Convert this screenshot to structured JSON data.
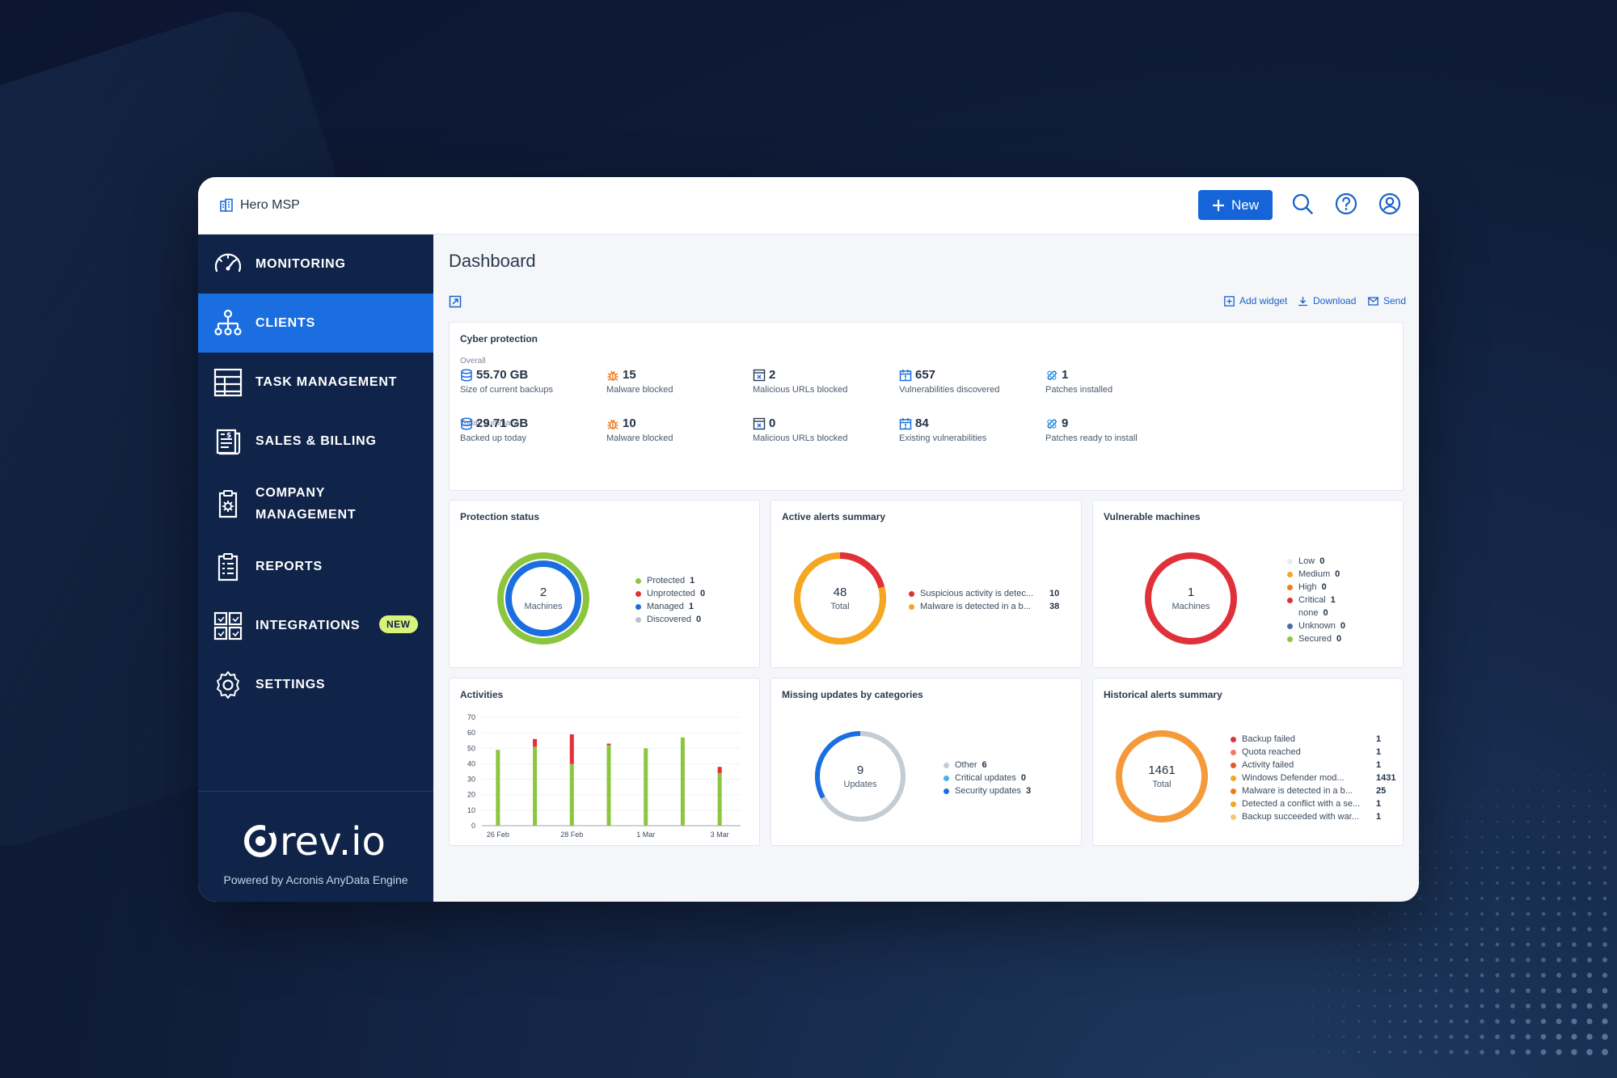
{
  "app": {
    "org_name": "Hero MSP",
    "new_button": "New",
    "page_title": "Dashboard"
  },
  "sidebar": {
    "items": [
      {
        "label": "MONITORING",
        "icon": "speedometer-icon"
      },
      {
        "label": "CLIENTS",
        "icon": "org-chart-icon",
        "active": true
      },
      {
        "label": "TASK MANAGEMENT",
        "icon": "task-board-icon"
      },
      {
        "label": "SALES & BILLING",
        "icon": "invoice-icon"
      },
      {
        "label_line1": "COMPANY",
        "label_line2": "MANAGEMENT",
        "icon": "clipboard-gear-icon"
      },
      {
        "label": "REPORTS",
        "icon": "report-clipboard-icon"
      },
      {
        "label": "INTEGRATIONS",
        "icon": "integrations-grid-icon",
        "badge": "NEW"
      },
      {
        "label": "SETTINGS",
        "icon": "gear-icon"
      }
    ],
    "logo_text": "rev.io",
    "powered_by": "Powered by Acronis AnyData Engine"
  },
  "toolbar": {
    "add_widget": "Add widget",
    "download": "Download",
    "send": "Send"
  },
  "cyber_protection": {
    "title": "Cyber protection",
    "overall_label": "Overall",
    "today_label": "Today summary",
    "overall": [
      {
        "value": "55.70 GB",
        "caption": "Size of current backups",
        "icon": "database-icon"
      },
      {
        "value": "15",
        "caption": "Malware blocked",
        "icon": "bug-icon"
      },
      {
        "value": "2",
        "caption": "Malicious URLs blocked",
        "icon": "blocked-url-icon"
      },
      {
        "value": "657",
        "caption": "Vulnerabilities discovered",
        "icon": "vulnerability-calendar-icon"
      },
      {
        "value": "1",
        "caption": "Patches installed",
        "icon": "patch-icon"
      }
    ],
    "today": [
      {
        "value": "29.71 GB",
        "caption": "Backed up today",
        "icon": "database-icon"
      },
      {
        "value": "10",
        "caption": "Malware blocked",
        "icon": "bug-icon"
      },
      {
        "value": "0",
        "caption": "Malicious URLs blocked",
        "icon": "blocked-url-icon"
      },
      {
        "value": "84",
        "caption": "Existing vulnerabilities",
        "icon": "vulnerability-calendar-icon"
      },
      {
        "value": "9",
        "caption": "Patches ready to install",
        "icon": "patch-icon"
      }
    ]
  },
  "protection_status": {
    "title": "Protection status",
    "center_value": "2",
    "center_label": "Machines",
    "legend": [
      {
        "label": "Protected",
        "value": "1",
        "color": "#8cc63f"
      },
      {
        "label": "Unprotected",
        "value": "0",
        "color": "#e0303a"
      },
      {
        "label": "Managed",
        "value": "1",
        "color": "#1a6ee0"
      },
      {
        "label": "Discovered",
        "value": "0",
        "color": "#b9c2cc"
      }
    ]
  },
  "active_alerts": {
    "title": "Active alerts summary",
    "center_value": "48",
    "center_label": "Total",
    "legend": [
      {
        "label": "Suspicious activity is detec...",
        "value": "10",
        "color": "#e0303a"
      },
      {
        "label": "Malware is detected in a b...",
        "value": "38",
        "color": "#f5a623"
      }
    ]
  },
  "vulnerable_machines": {
    "title": "Vulnerable machines",
    "center_value": "1",
    "center_label": "Machines",
    "legend": [
      {
        "label": "Low",
        "value": "0",
        "color": "#e8ecf2"
      },
      {
        "label": "Medium",
        "value": "0",
        "color": "#f5a623"
      },
      {
        "label": "High",
        "value": "0",
        "color": "#f07b1d"
      },
      {
        "label": "Critical",
        "value": "1",
        "color": "#e0303a"
      },
      {
        "label": "none",
        "value": "0",
        "color": ""
      },
      {
        "label": "Unknown",
        "value": "0",
        "color": "#4a6fa5"
      },
      {
        "label": "Secured",
        "value": "0",
        "color": "#8cc63f"
      }
    ]
  },
  "activities": {
    "title": "Activities"
  },
  "missing_updates": {
    "title": "Missing updates by categories",
    "center_value": "9",
    "center_label": "Updates",
    "legend": [
      {
        "label": "Other",
        "value": "6",
        "color": "#c5ccd4"
      },
      {
        "label": "Critical updates",
        "value": "0",
        "color": "#49b3e8"
      },
      {
        "label": "Security updates",
        "value": "3",
        "color": "#1a6ee0"
      }
    ]
  },
  "historical_alerts": {
    "title": "Historical alerts summary",
    "center_value": "1461",
    "center_label": "Total",
    "legend": [
      {
        "label": "Backup failed",
        "value": "1",
        "color": "#e0303a"
      },
      {
        "label": "Quota reached",
        "value": "1",
        "color": "#f27a6b"
      },
      {
        "label": "Activity failed",
        "value": "1",
        "color": "#e8552b"
      },
      {
        "label": "Windows Defender mod...",
        "value": "1431",
        "color": "#f5a623"
      },
      {
        "label": "Malware is detected in a b...",
        "value": "25",
        "color": "#f07b1d"
      },
      {
        "label": "Detected a conflict with a se...",
        "value": "1",
        "color": "#f5a623"
      },
      {
        "label": "Backup succeeded with war...",
        "value": "1",
        "color": "#f7c96b"
      }
    ]
  },
  "chart_data": {
    "type": "bar",
    "title": "Activities",
    "x_ticks": [
      "26 Feb",
      "28 Feb",
      "1 Mar",
      "3 Mar"
    ],
    "ylim": [
      0,
      70
    ],
    "y_ticks": [
      0,
      10,
      20,
      30,
      40,
      50,
      60,
      70
    ],
    "grid": true,
    "series": [
      {
        "color": "#8cc63f",
        "values": [
          49,
          51,
          40,
          52,
          50,
          57,
          34
        ]
      },
      {
        "color": "#e0303a",
        "values": [
          0,
          5,
          19,
          1,
          0,
          0,
          4
        ]
      }
    ],
    "stacked": true
  }
}
